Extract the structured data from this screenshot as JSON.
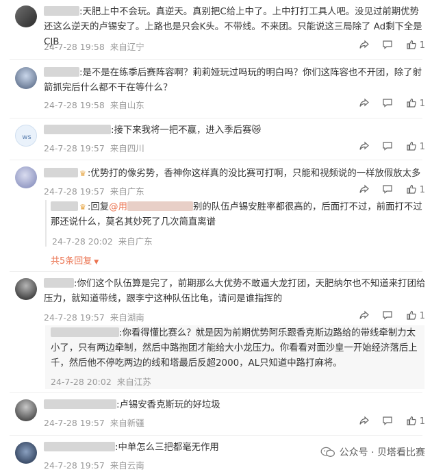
{
  "comments": [
    {
      "text": ":天肥上中不会玩。真逆天。真别把C给上中了。上中打打工具人吧。没见过前期优势还这么逆天的卢锡安了。上路也是只会K头。不带线。不来团。只能说这三局除了 Ad剩下全是CJB",
      "time": "24-7-28 19:58",
      "location": "来自辽宁",
      "likes": "1"
    },
    {
      "text": ":是不是在练季后赛阵容啊？莉莉娅玩过吗玩的明白吗？你们这阵容也不开团，除了射箭抓完后什么都不干在等什么？",
      "time": "24-7-28 19:58",
      "location": "来自山东",
      "likes": "1"
    },
    {
      "text": ":接下来我将一把不赢，进入季后赛😿",
      "time": "24-7-28 19:57",
      "location": "来自四川",
      "likes": "1"
    },
    {
      "text": ":优势打的像劣势，香神你这样真的没比赛可打啊，只能和视频说的一样放假放太多",
      "time": "24-7-28 19:57",
      "location": "来自广东",
      "likes": "1"
    },
    {
      "text": ":你们这个队伍算是完了，前期那么大优势不敢逼大龙打团，天肥纳尔也不知道来打团给压力，就知道带线，跟李宁这种队伍比龟，请问是谁指挥的",
      "time": "24-7-28 19:57",
      "location": "来自湖南",
      "likes": "1"
    },
    {
      "text": ":卢锡安香克斯玩的好垃圾",
      "time": "24-7-28 19:57",
      "location": "来自新疆",
      "likes": "1"
    },
    {
      "text": ":中单怎么三把都毫无作用",
      "time": "24-7-28 19:57",
      "location": "来自云南",
      "likes": "1"
    }
  ],
  "replies": {
    "r1": {
      "prefix": ":回复",
      "at": "@用",
      "text": "别的队伍卢锡安胜率都很高的，后面打不过，前面打不过那还说什么，莫名其妙死了几次简直离谱",
      "time": "24-7-28 20:02",
      "location": "来自广东",
      "more_label": "共5条回复"
    },
    "r2": {
      "text": ":你看得懂比赛么？就是因为前期优势阿乐跟香克斯边路给的带线牵制力太小了，只有两边牵制，然后中路抱团才能给大小龙压力。你看看对面沙皇一开始经济落后上千，然后他不停吃两边的线和塔最后反超2000，AL只知道中路打麻将。",
      "time": "24-7-28 20:02",
      "location": "来自江苏"
    }
  },
  "watermark": {
    "label": "公众号 · 贝塔看比赛",
    "icon": "wechat-icon"
  },
  "colors": {
    "accent": "#eb7350",
    "meta": "#999999",
    "text": "#333333"
  }
}
